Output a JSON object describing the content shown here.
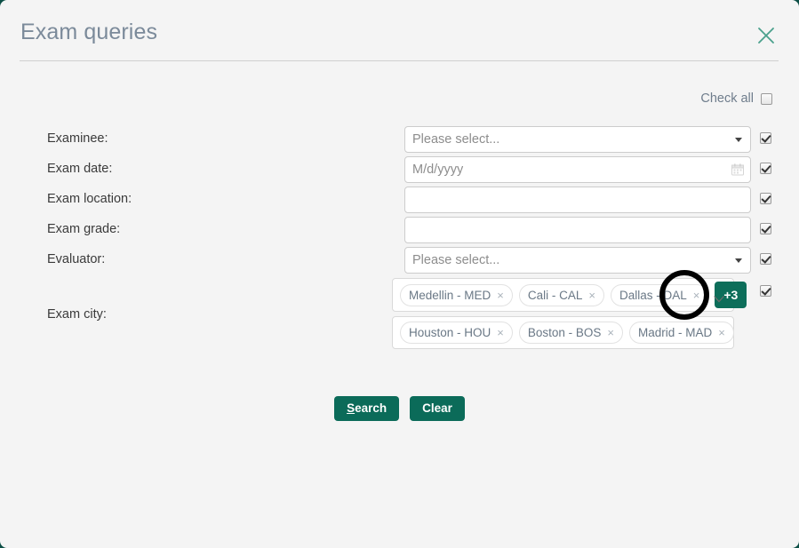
{
  "modal": {
    "title": "Exam queries",
    "close_icon": "close-icon"
  },
  "check_all": {
    "label": "Check all",
    "checked": false
  },
  "fields": [
    {
      "label": "Examinee:",
      "type": "select",
      "value": "",
      "placeholder": "Please select...",
      "checked": true,
      "icon": "chevron-down-icon"
    },
    {
      "label": "Exam date:",
      "type": "date",
      "value": "",
      "placeholder": "M/d/yyyy",
      "checked": true,
      "icon": "calendar-icon"
    },
    {
      "label": "Exam location:",
      "type": "text",
      "value": "",
      "placeholder": "",
      "checked": true,
      "icon": ""
    },
    {
      "label": "Exam grade:",
      "type": "text",
      "value": "",
      "placeholder": "",
      "checked": true,
      "icon": ""
    },
    {
      "label": "Evaluator:",
      "type": "select",
      "value": "",
      "placeholder": "Please select...",
      "checked": true,
      "icon": "chevron-down-icon"
    }
  ],
  "exam_city": {
    "label": "Exam city:",
    "checked": true,
    "visible_chips": [
      {
        "text": "Medellin - MED",
        "remove": "×"
      },
      {
        "text": "Cali - CAL",
        "remove": "×"
      },
      {
        "text": "Dallas - DAL",
        "remove": "×"
      }
    ],
    "overflow_badge": "+3",
    "overflow_chips": [
      {
        "text": "Houston - HOU",
        "remove": "×"
      },
      {
        "text": "Boston - BOS",
        "remove": "×"
      },
      {
        "text": "Madrid - MAD",
        "remove": "×"
      }
    ],
    "expand_icon": "chevron-down-icon"
  },
  "actions": {
    "search_accesskey": "S",
    "search_rest": "earch",
    "clear_label": "Clear"
  },
  "colors": {
    "accent": "#0b6b59",
    "badge": "#0d6e5a",
    "title": "#7b8a9a",
    "highlight": "#000000",
    "background": "#f4f4f4"
  }
}
